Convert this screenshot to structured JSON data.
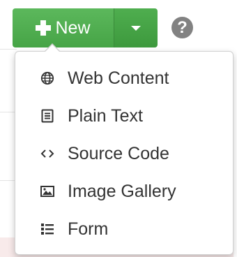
{
  "toolbar": {
    "new_label": "New",
    "accent_color": "#5cb85c",
    "icons": {
      "new": "plus-icon",
      "dropdown": "caret-down-icon",
      "help": "question-circle-icon"
    },
    "help_glyph": "?"
  },
  "menu": {
    "items": [
      {
        "label": "Web Content",
        "icon": "globe-icon"
      },
      {
        "label": "Plain Text",
        "icon": "file-text-icon"
      },
      {
        "label": "Source Code",
        "icon": "code-icon"
      },
      {
        "label": "Image Gallery",
        "icon": "picture-icon"
      },
      {
        "label": "Form",
        "icon": "list-icon"
      }
    ]
  }
}
